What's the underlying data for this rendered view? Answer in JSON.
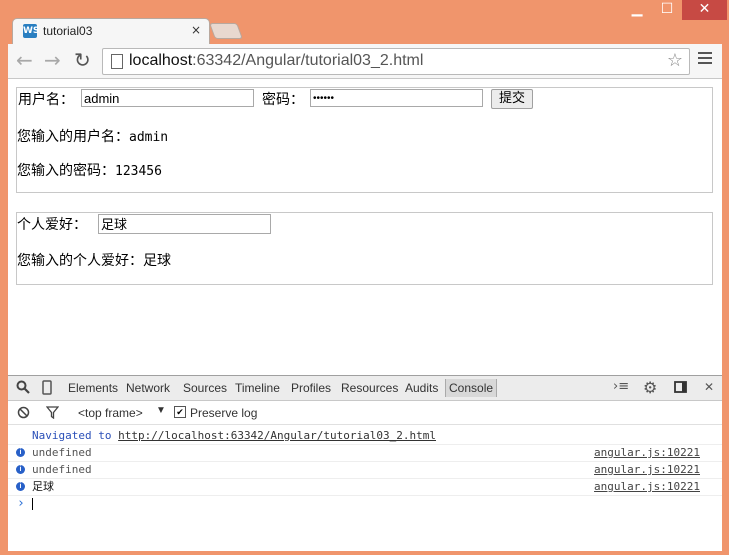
{
  "window": {
    "minimize": "▁",
    "maximize": "☐",
    "close": "✕"
  },
  "tab": {
    "favicon": "WS",
    "title": "tutorial03",
    "close": "×"
  },
  "toolbar": {
    "back": "←",
    "forward": "→",
    "reload": "↻",
    "url_host": "localhost",
    "url_rest": ":63342/Angular/tutorial03_2.html",
    "star": "☆"
  },
  "form1": {
    "username_label": "用户名：",
    "username_value": "admin",
    "password_label": "密码：",
    "password_value": "••••••",
    "submit_label": "提交",
    "username_output_label": "您输入的用户名：",
    "username_output": "admin",
    "password_output_label": "您输入的密码：",
    "password_output": "123456"
  },
  "form2": {
    "hobby_label": "个人爱好：",
    "hobby_value": "足球",
    "hobby_output": "您输入的个人爱好：足球"
  },
  "devtools": {
    "tabs": [
      "Elements",
      "Network",
      "Sources",
      "Timeline",
      "Profiles",
      "Resources",
      "Audits",
      "Console"
    ],
    "active_tab": "Console",
    "frame": "<top frame>",
    "preserve_log": "Preserve log",
    "navigated_text": "Navigated to",
    "navigated_url": "http://localhost:63342/Angular/tutorial03_2.html",
    "logs": [
      {
        "message": "undefined",
        "source": "angular.js:10221"
      },
      {
        "message": "undefined",
        "source": "angular.js:10221"
      },
      {
        "message": "足球",
        "source": "angular.js:10221"
      }
    ],
    "prompt": "›"
  }
}
